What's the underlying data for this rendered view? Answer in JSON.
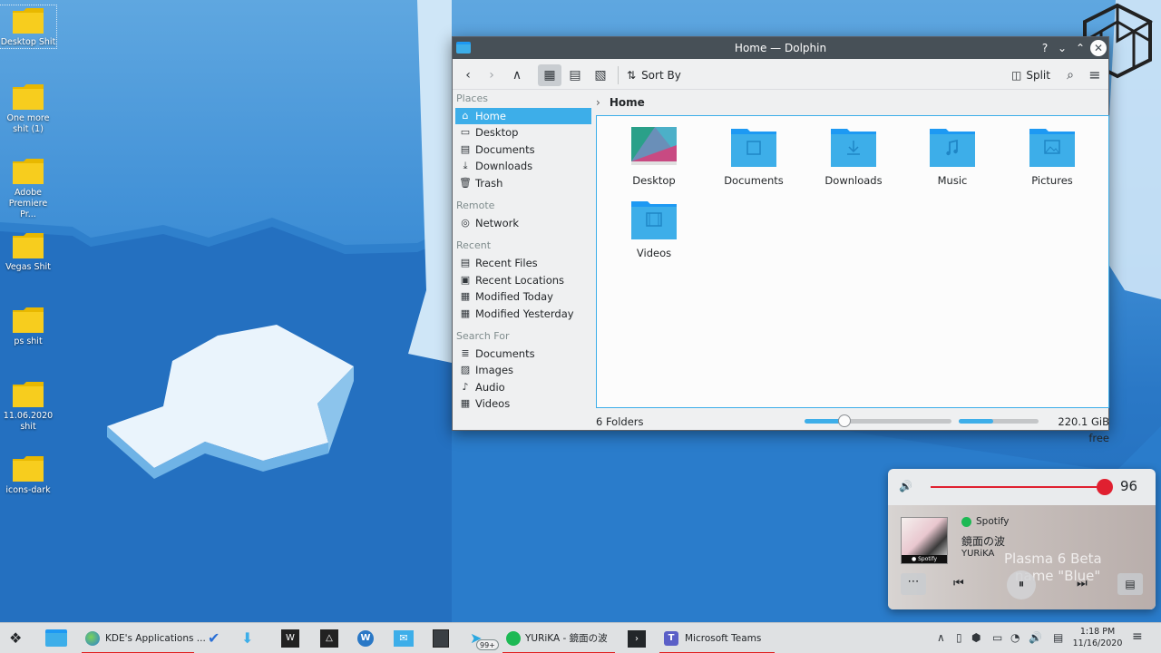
{
  "desktop": {
    "icons": [
      {
        "label": "Desktop Shit"
      },
      {
        "label": "One more shit (1)"
      },
      {
        "label": "Adobe Premiere Pr..."
      },
      {
        "label": "Vegas Shit"
      },
      {
        "label": "ps shit"
      },
      {
        "label": "11.06.2020 shit"
      },
      {
        "label": "icons-dark"
      }
    ]
  },
  "window": {
    "title": "Home — Dolphin",
    "buttons": {
      "help": "?",
      "minimize": "⌄",
      "maximize": "⌃",
      "close": "✕"
    },
    "toolbar": {
      "sort_label": "Sort By",
      "split_label": "Split"
    },
    "places": {
      "sections": [
        {
          "title": "Places",
          "items": [
            {
              "label": "Home",
              "icon": "home-icon",
              "glyph": "⌂",
              "selected": true
            },
            {
              "label": "Desktop",
              "icon": "desktop-icon",
              "glyph": "▭"
            },
            {
              "label": "Documents",
              "icon": "documents-icon",
              "glyph": "▤"
            },
            {
              "label": "Downloads",
              "icon": "downloads-icon",
              "glyph": "⤓"
            },
            {
              "label": "Trash",
              "icon": "trash-icon",
              "glyph": "🗑"
            }
          ]
        },
        {
          "title": "Remote",
          "items": [
            {
              "label": "Network",
              "icon": "network-icon",
              "glyph": "◎"
            }
          ]
        },
        {
          "title": "Recent",
          "items": [
            {
              "label": "Recent Files",
              "icon": "recent-files-icon",
              "glyph": "▤"
            },
            {
              "label": "Recent Locations",
              "icon": "recent-locations-icon",
              "glyph": "▣"
            },
            {
              "label": "Modified Today",
              "icon": "calendar-icon",
              "glyph": "▦"
            },
            {
              "label": "Modified Yesterday",
              "icon": "calendar-icon",
              "glyph": "▦"
            }
          ]
        },
        {
          "title": "Search For",
          "items": [
            {
              "label": "Documents",
              "icon": "documents-icon",
              "glyph": "≣"
            },
            {
              "label": "Images",
              "icon": "images-icon",
              "glyph": "▨"
            },
            {
              "label": "Audio",
              "icon": "audio-icon",
              "glyph": "♪"
            },
            {
              "label": "Videos",
              "icon": "videos-icon",
              "glyph": "▦"
            }
          ]
        }
      ]
    },
    "breadcrumb": "Home",
    "files": [
      {
        "label": "Desktop",
        "icon": "desktop-folder-icon"
      },
      {
        "label": "Documents",
        "icon": "documents-folder-icon"
      },
      {
        "label": "Downloads",
        "icon": "downloads-folder-icon"
      },
      {
        "label": "Music",
        "icon": "music-folder-icon"
      },
      {
        "label": "Pictures",
        "icon": "pictures-folder-icon"
      },
      {
        "label": "Videos",
        "icon": "videos-folder-icon"
      }
    ],
    "status": {
      "count": "6 Folders",
      "free_space": "220.1 GiB free",
      "zoom_fraction": 0.27,
      "disk_used_fraction": 0.43
    }
  },
  "media_popup": {
    "volume_value": "96",
    "volume_fraction": 0.96,
    "source": "Spotify",
    "track": "鏡面の波",
    "artist": "YURiKA",
    "background_text_line1": "Plasma 6 Beta",
    "background_text_line2": "name \"Blue\""
  },
  "taskbar": {
    "items": [
      {
        "label": "KDE's Applications ..."
      },
      {
        "label": "YURiKA - 鏡面の波"
      },
      {
        "label": "Microsoft Teams"
      }
    ],
    "badge": "99+",
    "clock_time": "1:18 PM",
    "clock_date": "11/16/2020"
  },
  "colors": {
    "accent": "#3daee9",
    "titlebar": "#475057",
    "folder": "#3daee9",
    "desktop_folder": "#f5c400",
    "volume": "#e02030"
  }
}
